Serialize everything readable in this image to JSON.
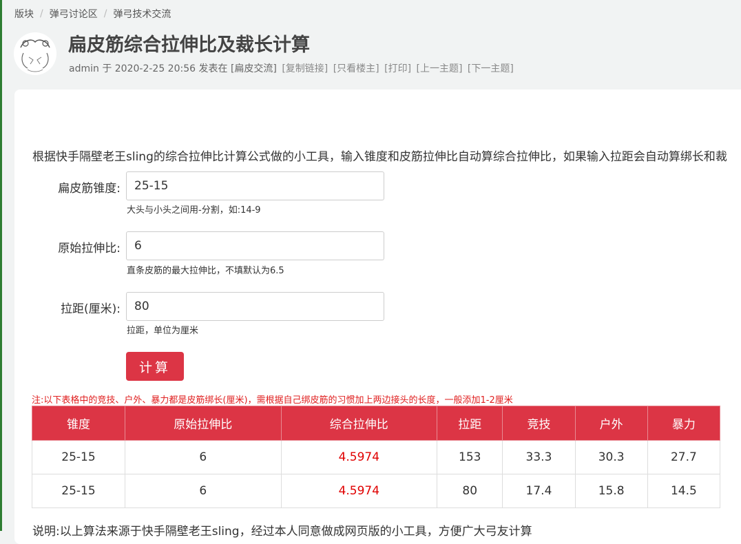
{
  "breadcrumb": [
    "版块",
    "弹弓讨论区",
    "弹弓技术交流"
  ],
  "thread": {
    "title": "扁皮筋综合拉伸比及裁长计算",
    "author": "admin",
    "meta_text": "于 2020-2-25 20:56 发表在",
    "forum": "[扁皮交流]",
    "links": [
      "[复制链接]",
      "[只看楼主]",
      "[打印]",
      "[上一主题]",
      "[下一主题]"
    ]
  },
  "intro": "根据快手隔壁老王sling的综合拉伸比计算公式做的小工具，输入锥度和皮筋拉伸比自动算综合拉伸比，如果输入拉距会自动算绑长和裁",
  "form": {
    "taper": {
      "label": "扁皮筋锥度:",
      "value": "25-15",
      "help": "大头与小头之间用-分割，如:14-9"
    },
    "ratio": {
      "label": "原始拉伸比:",
      "value": "6",
      "help": "直条皮筋的最大拉伸比，不填默认为6.5"
    },
    "draw": {
      "label": "拉距(厘米):",
      "value": "80",
      "help": "拉距，单位为厘米"
    },
    "submit_label": "计算"
  },
  "note": "注:以下表格中的竞技、户外、暴力都是皮筋绑长(厘米)，需根据自己绑皮筋的习惯加上两边接头的长度，一般添加1-2厘米",
  "table": {
    "headers": [
      "锥度",
      "原始拉伸比",
      "综合拉伸比",
      "拉距",
      "竞技",
      "户外",
      "暴力"
    ],
    "rows": [
      [
        "25-15",
        "6",
        "4.5974",
        "153",
        "33.3",
        "30.3",
        "27.7"
      ],
      [
        "25-15",
        "6",
        "4.5974",
        "80",
        "17.4",
        "15.8",
        "14.5"
      ]
    ]
  },
  "footer": "说明:以上算法来源于快手隔壁老王sling，经过本人同意做成网页版的小工具，方便广大弓友计算",
  "colors": {
    "accent": "#dc3545",
    "note": "#e02020",
    "highlight": "#e00000"
  },
  "icons": {
    "avatar": "avatar-sketch-icon"
  }
}
